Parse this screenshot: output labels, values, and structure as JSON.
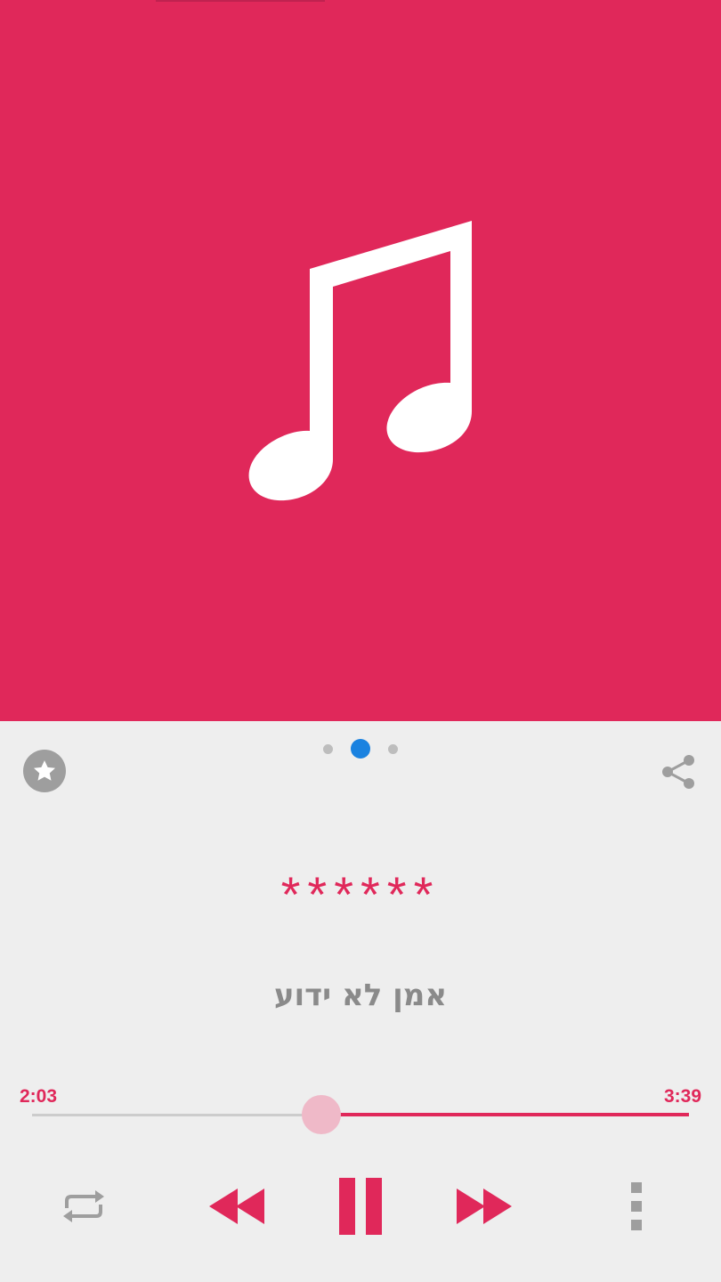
{
  "colors": {
    "accent": "#e0285a",
    "art_background": "#e0285a",
    "page_dot_active": "#1a82e0",
    "icon_gray": "#9e9e9e",
    "background": "#eeeeee"
  },
  "album_art": {
    "icon": "music-note-icon"
  },
  "pager": {
    "count": 3,
    "active_index": 1
  },
  "actions": {
    "favorite_icon": "star-icon",
    "share_icon": "share-icon"
  },
  "track": {
    "title": "******",
    "artist": "אמן לא ידוע"
  },
  "progress": {
    "elapsed": "2:03",
    "total": "3:39",
    "fraction": 0.56
  },
  "controls": {
    "repeat_icon": "repeat-icon",
    "rewind_icon": "rewind-icon",
    "play_pause_icon": "pause-icon",
    "fast_forward_icon": "fast-forward-icon",
    "menu_icon": "more-vertical-icon"
  }
}
